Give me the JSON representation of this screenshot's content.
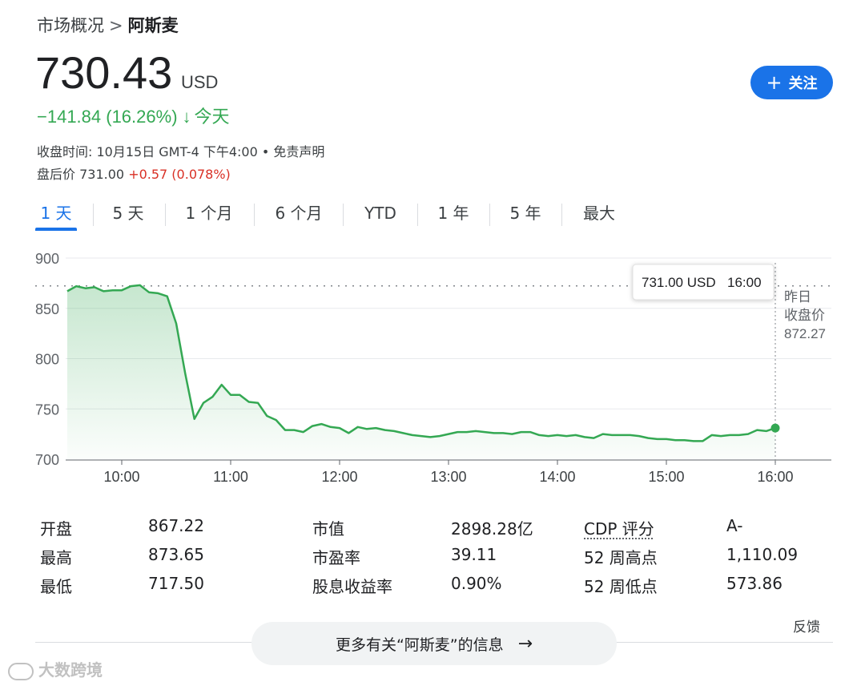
{
  "breadcrumb": {
    "parent": "市场概况",
    "separator": ">",
    "current": "阿斯麦"
  },
  "quote": {
    "price": "730.43",
    "currency": "USD",
    "change": "−141.84 (16.26%)",
    "change_arrow": "↓",
    "change_period": "今天",
    "close_info": "收盘时间: 10月15日 GMT-4 下午4:00 • 免责声明",
    "after_hours_label": "盘后价",
    "after_hours_price": "731.00",
    "after_hours_change": "+0.57 (0.078%)"
  },
  "follow_button": {
    "icon": "plus-icon",
    "label": "关注"
  },
  "tabs": [
    "1 天",
    "5 天",
    "1 个月",
    "6 个月",
    "YTD",
    "1 年",
    "5 年",
    "最大"
  ],
  "active_tab": "1 天",
  "chart_data": {
    "type": "area",
    "ylim": [
      700,
      900
    ],
    "y_ticks": [
      "900",
      "850",
      "800",
      "750",
      "700"
    ],
    "x_ticks": [
      "10:00",
      "11:00",
      "12:00",
      "13:00",
      "14:00",
      "15:00",
      "16:00"
    ],
    "xlim_hours": [
      9.5,
      16.0
    ],
    "reference_line": {
      "label_line1": "昨日",
      "label_line2": "收盘价",
      "value": "872.27"
    },
    "tooltip": {
      "price": "731.00 USD",
      "time": "16:00"
    },
    "line_color": "#34a853",
    "series": [
      {
        "points": [
          [
            "9:30",
            867
          ],
          [
            "9:35",
            872
          ],
          [
            "9:40",
            870
          ],
          [
            "9:45",
            871
          ],
          [
            "9:50",
            867
          ],
          [
            "9:55",
            868
          ],
          [
            "10:00",
            868
          ],
          [
            "10:05",
            872
          ],
          [
            "10:10",
            873
          ],
          [
            "10:15",
            866
          ],
          [
            "10:20",
            865
          ],
          [
            "10:25",
            862
          ],
          [
            "10:30",
            835
          ],
          [
            "10:35",
            785
          ],
          [
            "10:40",
            740
          ],
          [
            "10:45",
            756
          ],
          [
            "10:50",
            762
          ],
          [
            "10:55",
            774
          ],
          [
            "11:00",
            764
          ],
          [
            "11:05",
            764
          ],
          [
            "11:10",
            757
          ],
          [
            "11:15",
            756
          ],
          [
            "11:20",
            743
          ],
          [
            "11:25",
            739
          ],
          [
            "11:30",
            729
          ],
          [
            "11:35",
            729
          ],
          [
            "11:40",
            727
          ],
          [
            "11:45",
            733
          ],
          [
            "11:50",
            735
          ],
          [
            "11:55",
            732
          ],
          [
            "12:00",
            731
          ],
          [
            "12:05",
            726
          ],
          [
            "12:10",
            732
          ],
          [
            "12:15",
            730
          ],
          [
            "12:20",
            731
          ],
          [
            "12:25",
            729
          ],
          [
            "12:30",
            728
          ],
          [
            "12:35",
            726
          ],
          [
            "12:40",
            724
          ],
          [
            "12:45",
            723
          ],
          [
            "12:50",
            722
          ],
          [
            "12:55",
            723
          ],
          [
            "13:00",
            725
          ],
          [
            "13:05",
            727
          ],
          [
            "13:10",
            727
          ],
          [
            "13:15",
            728
          ],
          [
            "13:20",
            727
          ],
          [
            "13:25",
            726
          ],
          [
            "13:30",
            726
          ],
          [
            "13:35",
            725
          ],
          [
            "13:40",
            727
          ],
          [
            "13:45",
            727
          ],
          [
            "13:50",
            724
          ],
          [
            "13:55",
            723
          ],
          [
            "14:00",
            724
          ],
          [
            "14:05",
            723
          ],
          [
            "14:10",
            724
          ],
          [
            "14:15",
            722
          ],
          [
            "14:20",
            721
          ],
          [
            "14:25",
            725
          ],
          [
            "14:30",
            724
          ],
          [
            "14:35",
            724
          ],
          [
            "14:40",
            724
          ],
          [
            "14:45",
            723
          ],
          [
            "14:50",
            721
          ],
          [
            "14:55",
            720
          ],
          [
            "15:00",
            720
          ],
          [
            "15:05",
            719
          ],
          [
            "15:10",
            719
          ],
          [
            "15:15",
            718
          ],
          [
            "15:20",
            718
          ],
          [
            "15:25",
            724
          ],
          [
            "15:30",
            723
          ],
          [
            "15:35",
            724
          ],
          [
            "15:40",
            724
          ],
          [
            "15:45",
            725
          ],
          [
            "15:50",
            729
          ],
          [
            "15:55",
            728
          ],
          [
            "16:00",
            731
          ]
        ]
      }
    ]
  },
  "stats": [
    {
      "label": "开盘",
      "value": "867.22"
    },
    {
      "label": "最高",
      "value": "873.65"
    },
    {
      "label": "最低",
      "value": "717.50"
    },
    {
      "label": "市值",
      "value": "2898.28亿"
    },
    {
      "label": "市盈率",
      "value": "39.11"
    },
    {
      "label": "股息收益率",
      "value": "0.90%"
    },
    {
      "label": "CDP 评分",
      "value": "A-"
    },
    {
      "label": "52 周高点",
      "value": "1,110.09"
    },
    {
      "label": "52 周低点",
      "value": "573.86"
    }
  ],
  "feedback": "反馈",
  "more_info_button": {
    "label": "更多有关“阿斯麦”的信息",
    "icon": "arrow-right-icon"
  },
  "watermark": {
    "icon": "logo-icon",
    "text": "大数跨境"
  }
}
